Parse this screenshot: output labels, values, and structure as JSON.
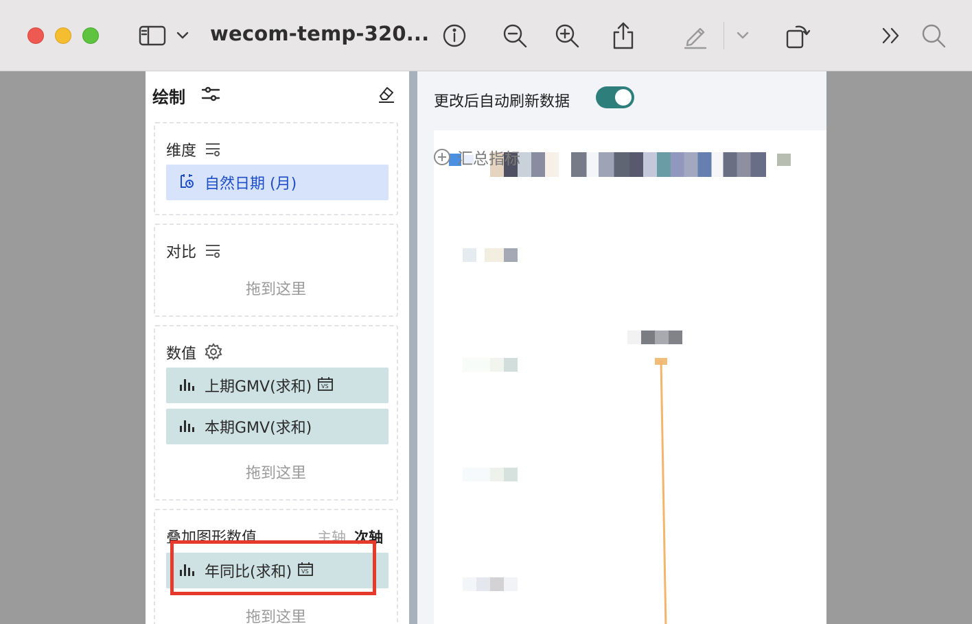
{
  "window": {
    "title": "wecom-temp-320...",
    "traffic_lights": [
      "close",
      "minimize",
      "zoom"
    ]
  },
  "toolbar": {
    "icons": [
      "sidebar-icon",
      "chevron-down-icon",
      "info-icon",
      "zoom-out-icon",
      "zoom-in-icon",
      "share-icon",
      "markup-pen-icon",
      "chevron-down-icon",
      "rotate-icon",
      "more-chevrons-icon",
      "search-icon"
    ]
  },
  "left_panel": {
    "header": "绘制",
    "dimension": {
      "title": "维度",
      "field": "自然日期 (月)"
    },
    "compare": {
      "title": "对比",
      "drop": "拖到这里"
    },
    "values": {
      "title": "数值",
      "fields": [
        "上期GMV(求和)",
        "本期GMV(求和)"
      ],
      "drop": "拖到这里"
    },
    "overlay": {
      "title": "叠加图形数值",
      "axis_primary": "主轴",
      "axis_secondary": "次轴",
      "field": "年同比(求和)",
      "drop": "拖到这里"
    }
  },
  "right_panel": {
    "auto_refresh_label": "更改后自动刷新数据",
    "auto_refresh_on": true,
    "add_metric": "汇总指标"
  },
  "colors": {
    "accent_teal": "#2e7f7c",
    "chip_blue": "#d7e3fb",
    "chip_teal": "#cee1e3",
    "highlight_red": "#e53a2c",
    "line_orange": "#f3b56b"
  }
}
